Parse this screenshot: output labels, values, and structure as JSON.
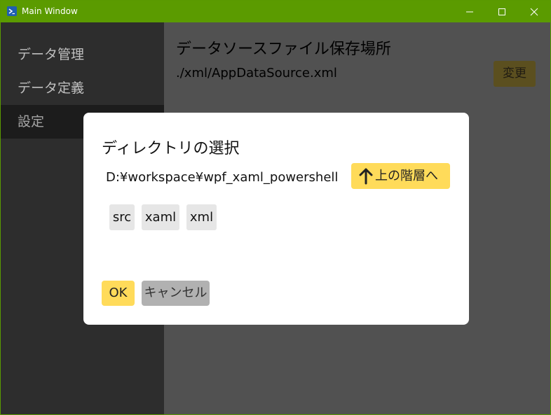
{
  "window": {
    "title": "Main Window",
    "accent_color": "#5b9b00",
    "icons": [
      "powershell-icon",
      "minimize-icon",
      "maximize-icon",
      "close-icon"
    ]
  },
  "sidebar": {
    "items": [
      {
        "label": "データ管理"
      },
      {
        "label": "データ定義"
      },
      {
        "label": "設定",
        "active": true
      }
    ]
  },
  "main": {
    "section_title": "データソースファイル保存場所",
    "section_value": "./xml/AppDataSource.xml",
    "change_label": "変更"
  },
  "dialog": {
    "title": "ディレクトリの選択",
    "path": "D:¥workspace¥wpf_xaml_powershell",
    "up_label": "上の階層へ",
    "up_icon": "arrow-up-icon",
    "folders": [
      "src",
      "xaml",
      "xml"
    ],
    "ok_label": "OK",
    "cancel_label": "キャンセル",
    "button_color": "#ffdb5a"
  }
}
